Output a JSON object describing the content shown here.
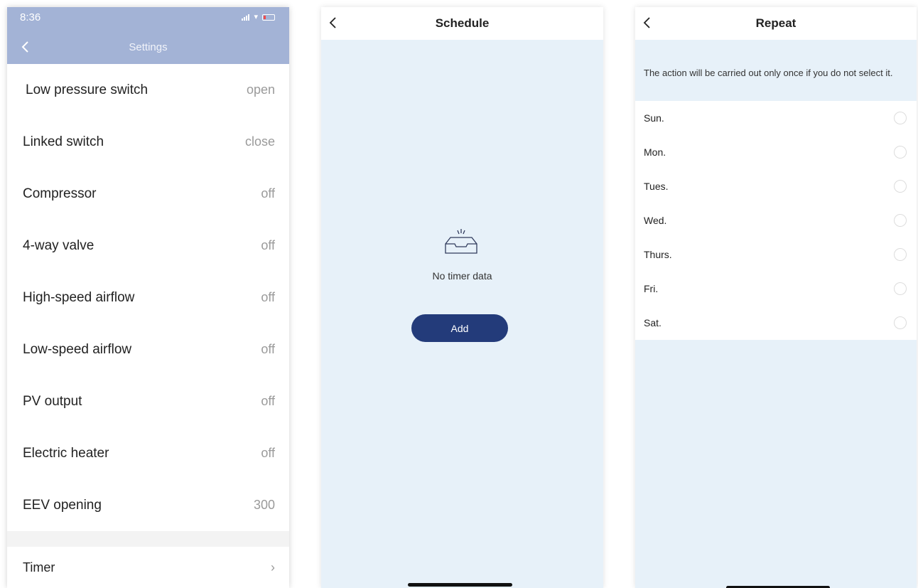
{
  "settings": {
    "status_time": "8:36",
    "title": "Settings",
    "rows": [
      {
        "label": "Low pressure switch",
        "value": "open"
      },
      {
        "label": "Linked switch",
        "value": "close"
      },
      {
        "label": "Compressor",
        "value": "off"
      },
      {
        "label": "4-way valve",
        "value": "off"
      },
      {
        "label": "High-speed airflow",
        "value": "off"
      },
      {
        "label": "Low-speed airflow",
        "value": "off"
      },
      {
        "label": "PV output",
        "value": "off"
      },
      {
        "label": "Electric heater",
        "value": "off"
      },
      {
        "label": "EEV opening",
        "value": "300"
      }
    ],
    "timer_label": "Timer",
    "back_icon": "chevron-left-icon",
    "timer_icon": "chevron-right-icon"
  },
  "schedule": {
    "title": "Schedule",
    "empty_text": "No timer data",
    "add_label": "Add",
    "empty_icon": "empty-tray-icon"
  },
  "repeat": {
    "title": "Repeat",
    "info": "The action will be carried out only once if you do not select it.",
    "days": [
      {
        "label": "Sun."
      },
      {
        "label": "Mon."
      },
      {
        "label": "Tues."
      },
      {
        "label": "Wed."
      },
      {
        "label": "Thurs."
      },
      {
        "label": "Fri."
      },
      {
        "label": "Sat."
      }
    ]
  },
  "colors": {
    "header_bg": "#a3b3d6",
    "panel_bg": "#e7f1f9",
    "button_bg": "#233b7a",
    "value_text": "#9a9a9a"
  }
}
